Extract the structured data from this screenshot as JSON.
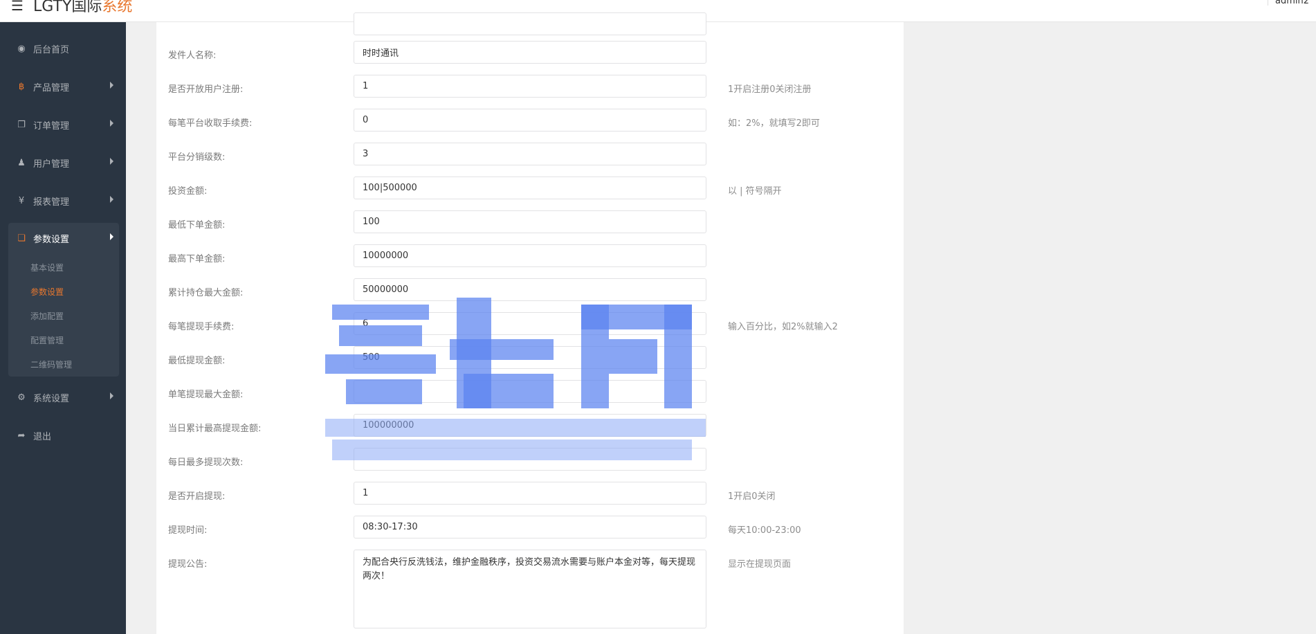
{
  "header": {
    "brand_main": "LGTY国际",
    "brand_highlight": "系统",
    "user_name": "admin2",
    "icons": {
      "menu_toggle": "hamburger-icon"
    }
  },
  "sidebar": {
    "items": [
      {
        "label": "后台首页",
        "icon": "dashboard-icon",
        "glyph": "◉"
      },
      {
        "label": "产品管理",
        "icon": "bitcoin-icon",
        "glyph": "฿"
      },
      {
        "label": "订单管理",
        "icon": "copy-icon",
        "glyph": "❐"
      },
      {
        "label": "用户管理",
        "icon": "user-icon",
        "glyph": "♟"
      },
      {
        "label": "报表管理",
        "icon": "yen-icon",
        "glyph": "¥"
      },
      {
        "label": "参数设置",
        "icon": "files-icon",
        "glyph": "❏"
      },
      {
        "label": "系统设置",
        "icon": "gears-icon",
        "glyph": "⚙"
      },
      {
        "label": "退出",
        "icon": "sign-out-icon",
        "glyph": "➦"
      }
    ],
    "submenu": [
      {
        "label": "基本设置"
      },
      {
        "label": "参数设置",
        "active": true
      },
      {
        "label": "添加配置"
      },
      {
        "label": "配置管理"
      },
      {
        "label": "二维码管理"
      }
    ],
    "accent_color": "#e8772e",
    "bg_color": "#2a3542"
  },
  "form": {
    "rows": [
      {
        "label": "发件人名称:",
        "value": "时时通讯",
        "hint": ""
      },
      {
        "label": "是否开放用户注册:",
        "value": "1",
        "hint": "1开启注册0关闭注册"
      },
      {
        "label": "每笔平台收取手续费:",
        "value": "0",
        "hint": "如：2%，就填写2即可"
      },
      {
        "label": "平台分销级数:",
        "value": "3",
        "hint": ""
      },
      {
        "label": "投资金额:",
        "value": "100|500000",
        "hint": "以 | 符号隔开"
      },
      {
        "label": "最低下单金额:",
        "value": "100",
        "hint": ""
      },
      {
        "label": "最高下单金额:",
        "value": "10000000",
        "hint": ""
      },
      {
        "label": "累计持仓最大金额:",
        "value": "50000000",
        "hint": ""
      },
      {
        "label": "每笔提现手续费:",
        "value": "6",
        "hint": "输入百分比，如2%就输入2"
      },
      {
        "label": "最低提现金额:",
        "value": "500",
        "hint": ""
      },
      {
        "label": "单笔提现最大金额:",
        "value": "",
        "hint": ""
      },
      {
        "label": "当日累计最高提现金额:",
        "value": "100000000",
        "hint": ""
      },
      {
        "label": "每日最多提现次数:",
        "value": "",
        "hint": ""
      },
      {
        "label": "是否开启提现:",
        "value": "1",
        "hint": "1开启0关闭"
      },
      {
        "label": "提现时间:",
        "value": "08:30-17:30",
        "hint": "每天10:00-23:00"
      }
    ],
    "notice": {
      "label": "提现公告:",
      "value": "为配合央行反洗钱法，维护金融秩序，投资交易流水需要与账户本金对等，每天提现两次！",
      "hint": "显示在提现页面"
    }
  }
}
